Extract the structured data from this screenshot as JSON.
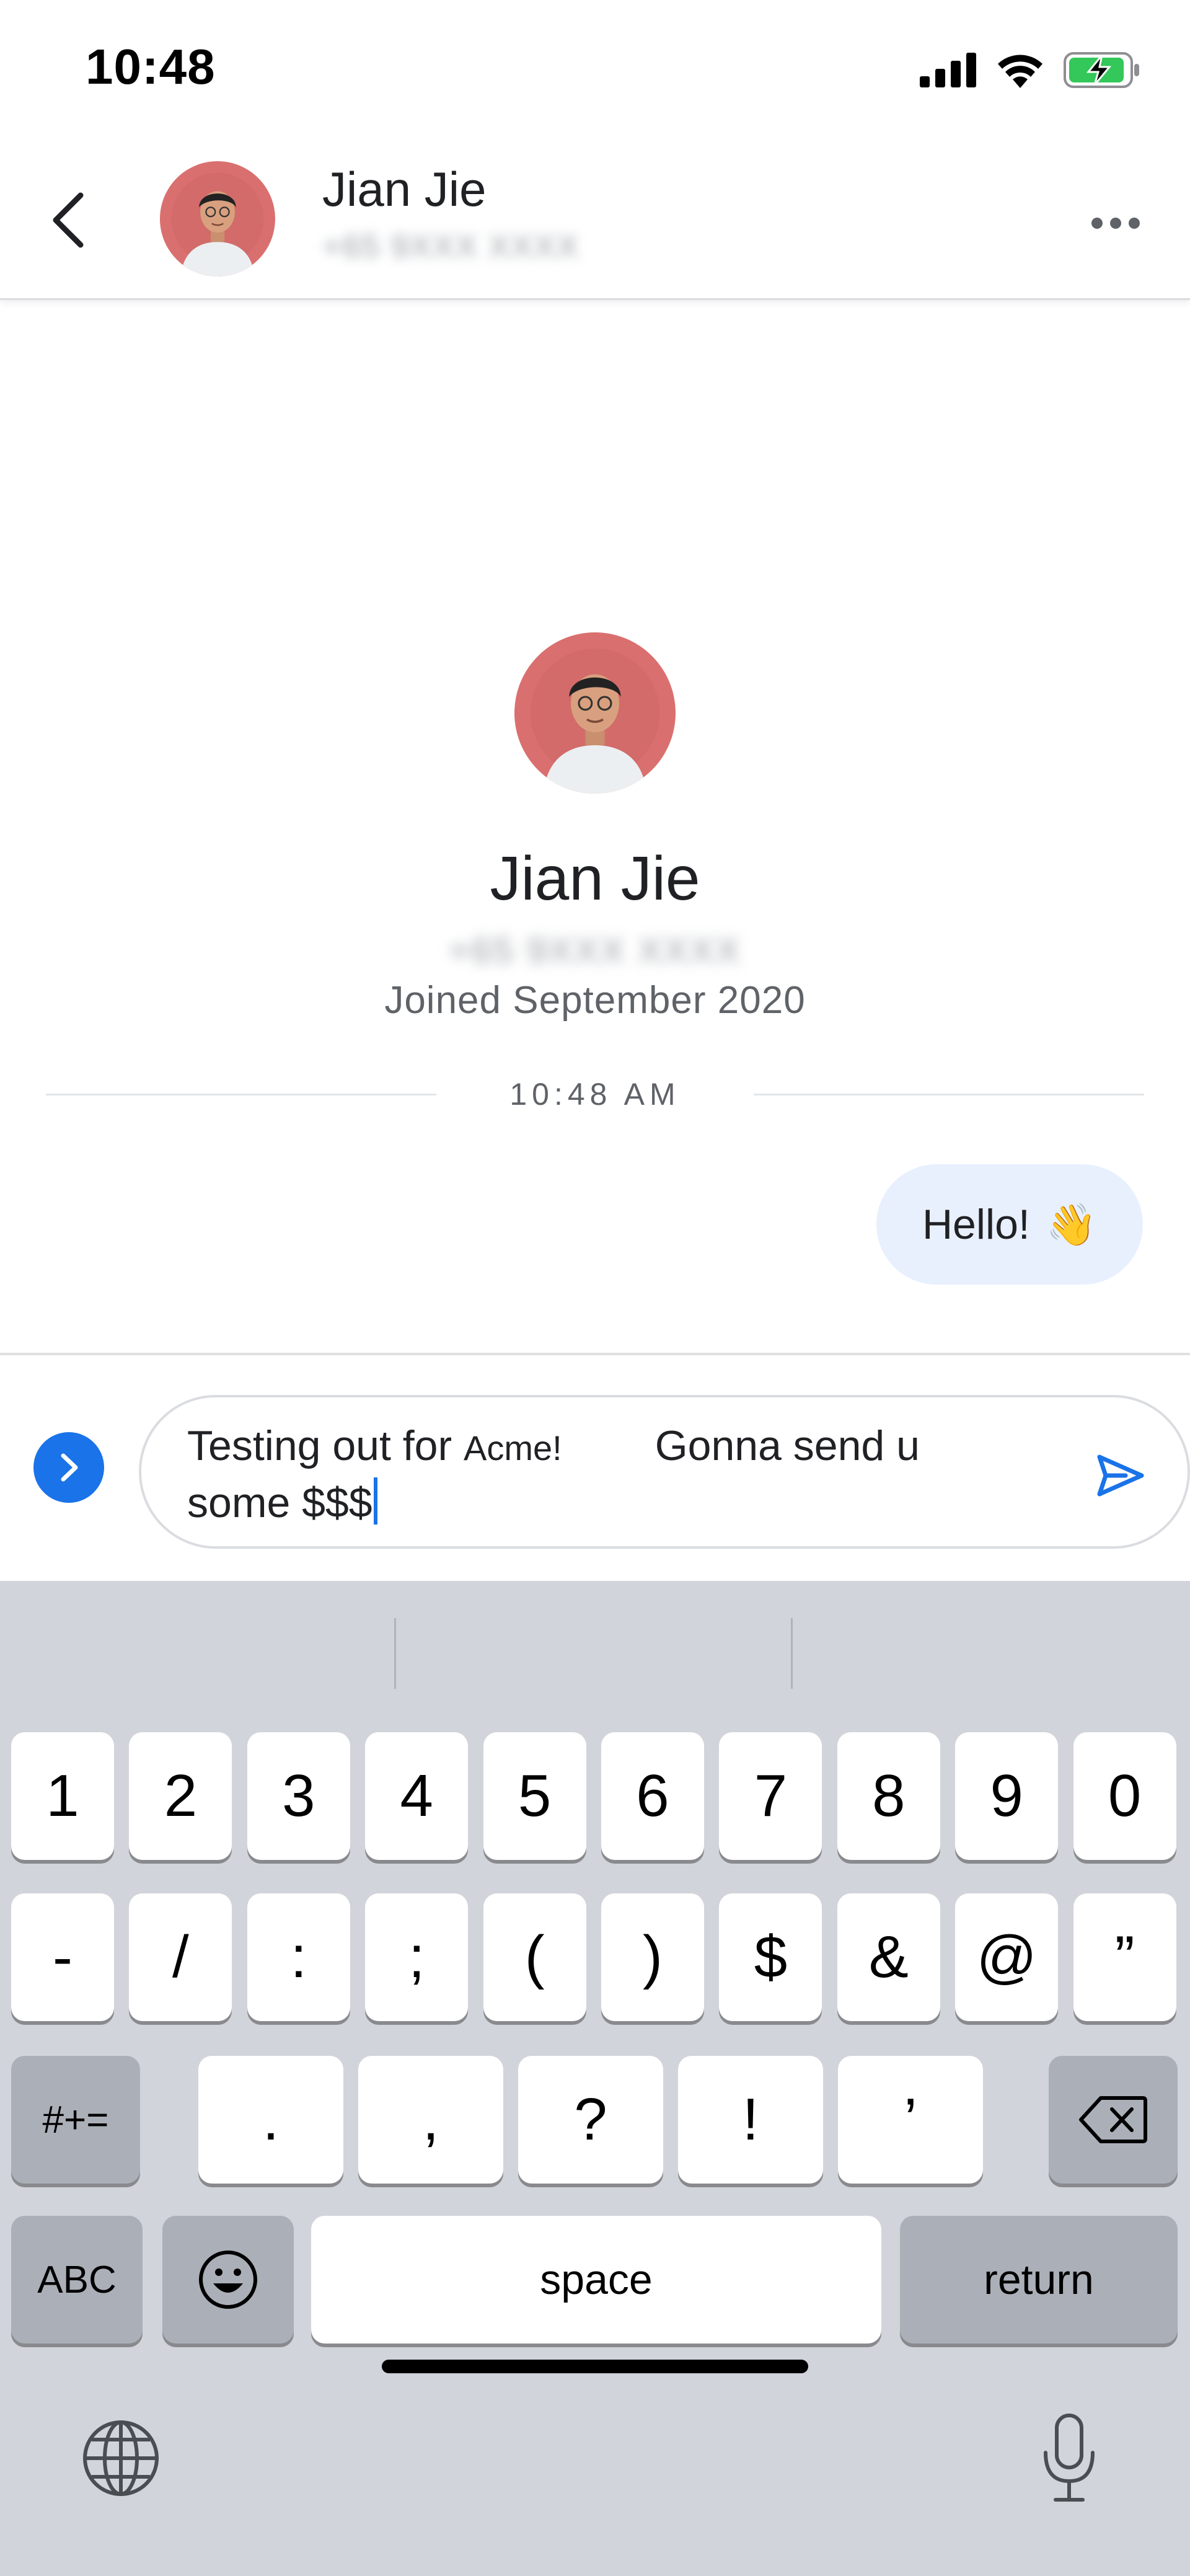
{
  "status_bar": {
    "time": "10:48"
  },
  "header": {
    "name": "Jian Jie",
    "phone": "+65 9XXX XXXX"
  },
  "profile": {
    "name": "Jian Jie",
    "phone": "+65 9XXX XXXX",
    "joined": "Joined September 2020"
  },
  "divider": {
    "time": "10:48 AM"
  },
  "message": {
    "text": "Hello!",
    "emoji": "👋"
  },
  "compose": {
    "text_part1": "Testing out for ",
    "brand": "Acme!",
    "text_part2": "Gonna send u some $$$"
  },
  "keyboard": {
    "row1": [
      "1",
      "2",
      "3",
      "4",
      "5",
      "6",
      "7",
      "8",
      "9",
      "0"
    ],
    "row2": [
      "-",
      "/",
      ":",
      ";",
      "(",
      ")",
      "$",
      "&",
      "@",
      "”"
    ],
    "row3": [
      ".",
      ",",
      "?",
      "!",
      "’"
    ],
    "symbols_label": "#+=",
    "abc_label": "ABC",
    "space_label": "space",
    "return_label": "return"
  },
  "colors": {
    "accent": "#1a73e8",
    "bubble": "#e8f0fe",
    "avatar_bg": "#d9706f",
    "keyboard_bg": "#d1d4da"
  },
  "icons": [
    "signal-icon",
    "wifi-icon",
    "battery-charging-icon",
    "back-icon",
    "more-icon",
    "expand-icon",
    "send-icon",
    "backspace-icon",
    "emoji-icon",
    "globe-icon",
    "mic-icon"
  ]
}
